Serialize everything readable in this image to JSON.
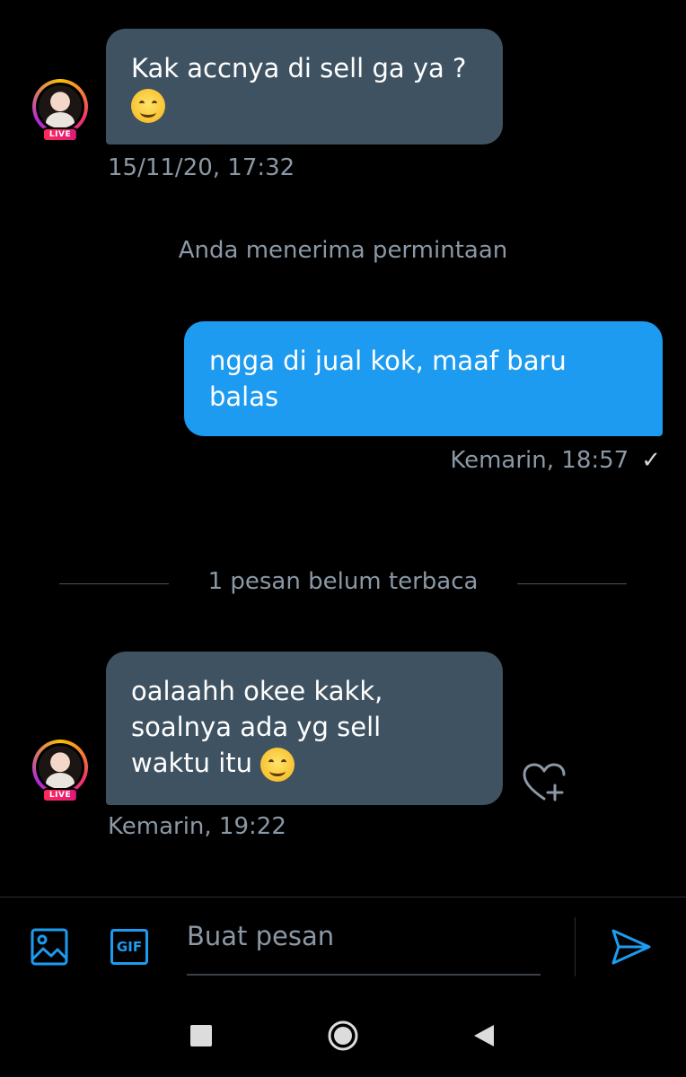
{
  "messages": [
    {
      "direction": "in",
      "text": "Kak accnya di sell ga ya ?",
      "emoji": "smiling-face-emoji",
      "time": "15/11/20, 17:32",
      "avatar_badge": "LIVE"
    },
    {
      "direction": "out",
      "line1": "ngga di jual kok, maaf baru",
      "line2": "balas",
      "time": "Kemarin, 18:57",
      "status_mark": "✓"
    },
    {
      "direction": "in",
      "line1": "oalaahh okee kakk,",
      "line2": "soalnya ada yg sell",
      "line3": "waktu itu",
      "emoji": "smiling-face-emoji",
      "time": "Kemarin, 19:22",
      "avatar_badge": "LIVE"
    }
  ],
  "system_notice": "Anda menerima permintaan",
  "unread_divider": "1 pesan belum terbaca",
  "composer": {
    "placeholder": "Buat pesan",
    "gif_label": "GIF",
    "accent_color": "#1d9bf0"
  },
  "icons": {
    "image": "image-icon",
    "gif": "gif-icon",
    "send": "send-icon",
    "react": "heart-plus-icon",
    "nav_recents": "square-icon",
    "nav_home": "circle-icon",
    "nav_back": "triangle-back-icon"
  },
  "colors": {
    "background": "#000000",
    "bubble_in": "#3f5261",
    "bubble_out": "#1d9bf0",
    "meta_text": "#8b98a5"
  }
}
